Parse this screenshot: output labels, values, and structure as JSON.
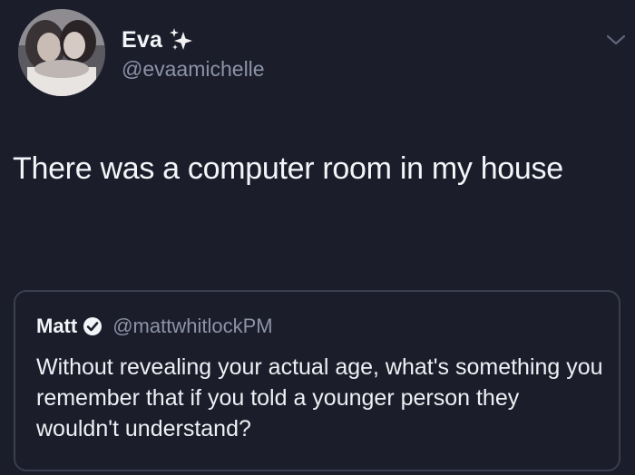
{
  "tweet": {
    "author": {
      "display_name": "Eva",
      "name_emoji_icon": "sparkles-icon",
      "handle": "@evaamichelle",
      "avatar_icon": "avatar"
    },
    "menu_icon": "chevron-down-icon",
    "text": "There was a computer room in my house"
  },
  "quoted_tweet": {
    "author": {
      "display_name": "Matt",
      "verified_icon": "verified-icon",
      "handle": "@mattwhitlockPM"
    },
    "text": "Without revealing your actual age, what's something you remember that if you told a younger person they wouldn't understand?"
  },
  "colors": {
    "background": "#1b1d2b",
    "text_primary": "#f4f5f8",
    "text_secondary": "#8c93a6",
    "card_border": "#3a3e4e",
    "sparkle_color": "#f2f2f2"
  }
}
